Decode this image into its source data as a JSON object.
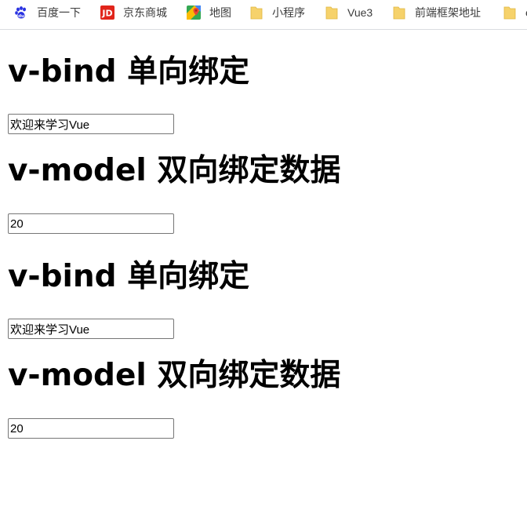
{
  "bookmarks": [
    {
      "label": "百度一下",
      "icon": "baidu-paw-icon"
    },
    {
      "label": "京东商城",
      "icon": "jd-logo-icon"
    },
    {
      "label": "地图",
      "icon": "maps-pin-icon"
    },
    {
      "label": "小程序",
      "icon": "folder-icon"
    },
    {
      "label": "Vue3",
      "icon": "folder-icon"
    },
    {
      "label": "前端框架地址",
      "icon": "folder-icon"
    },
    {
      "label": "e",
      "icon": "folder-icon"
    }
  ],
  "sections": [
    {
      "heading": "v-bind 单向绑定",
      "input_value": "欢迎来学习Vue"
    },
    {
      "heading": "v-model 双向绑定数据",
      "input_value": "20"
    },
    {
      "heading": "v-bind 单向绑定",
      "input_value": "欢迎来学习Vue"
    },
    {
      "heading": "v-model 双向绑定数据",
      "input_value": "20"
    }
  ],
  "colors": {
    "folder": "#f6d26b",
    "baidu": "#2932e1",
    "jd": "#e1251b"
  }
}
